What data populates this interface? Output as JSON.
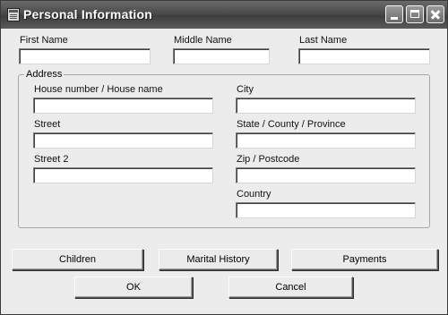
{
  "window": {
    "title": "Personal Information"
  },
  "form": {
    "first_name": {
      "label": "First Name",
      "value": ""
    },
    "middle_name": {
      "label": "Middle Name",
      "value": ""
    },
    "last_name": {
      "label": "Last Name",
      "value": ""
    }
  },
  "address": {
    "legend": "Address",
    "house_number": {
      "label": "House number / House name",
      "value": ""
    },
    "street": {
      "label": "Street",
      "value": ""
    },
    "street2": {
      "label": "Street 2",
      "value": ""
    },
    "city": {
      "label": "City",
      "value": ""
    },
    "state": {
      "label": "State / County / Province",
      "value": ""
    },
    "zip": {
      "label": "Zip / Postcode",
      "value": ""
    },
    "country": {
      "label": "Country",
      "value": ""
    }
  },
  "buttons": {
    "children": "Children",
    "marital_history": "Marital History",
    "payments": "Payments",
    "ok": "OK",
    "cancel": "Cancel"
  },
  "icons": {
    "app": "form-window-icon",
    "minimize": "minimize-icon",
    "maximize": "maximize-icon",
    "close": "close-icon"
  }
}
